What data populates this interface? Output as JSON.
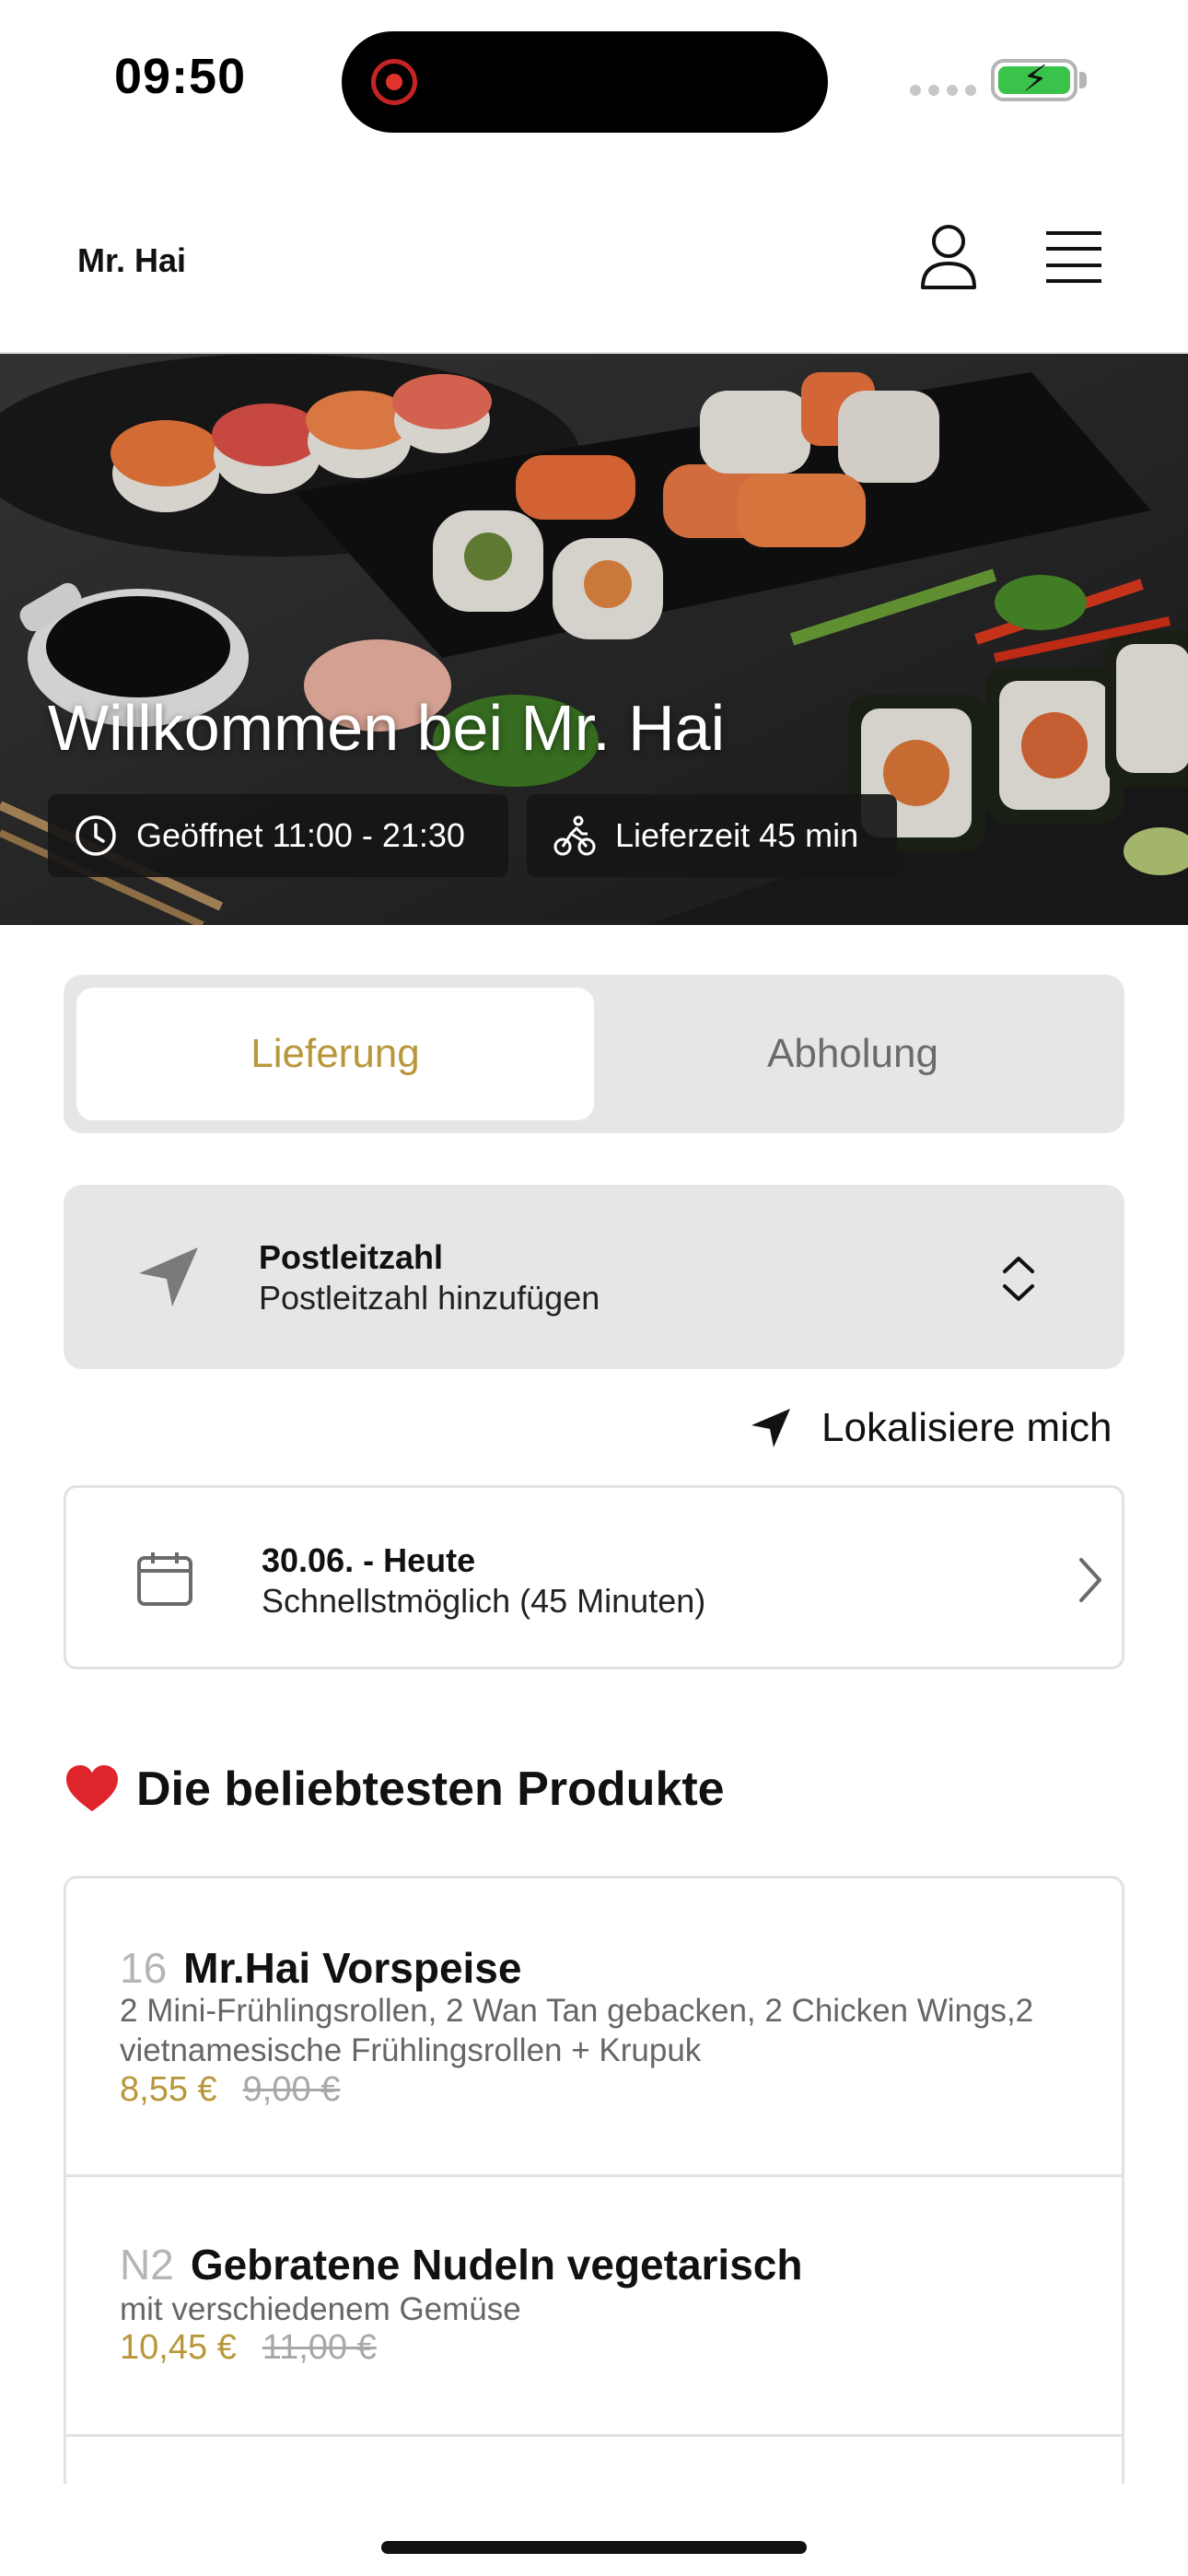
{
  "status_bar": {
    "time": "09:50"
  },
  "header": {
    "brand": "Mr. Hai",
    "icons": [
      "user-icon",
      "menu-icon"
    ]
  },
  "hero": {
    "title": "Willkommen bei Mr. Hai",
    "opening_hours": "Geöffnet 11:00 - 21:30",
    "delivery_time": "Lieferzeit 45 min"
  },
  "order_mode": {
    "options": [
      "Lieferung",
      "Abholung"
    ],
    "selected": "Lieferung"
  },
  "postcode": {
    "label": "Postleitzahl",
    "value": "Postleitzahl hinzufügen"
  },
  "locate": {
    "label": "Lokalisiere mich"
  },
  "date": {
    "label": "30.06. - Heute",
    "value": "Schnellstmöglich (45 Minuten)"
  },
  "popular": {
    "title": "Die beliebtesten Produkte",
    "products": [
      {
        "number": "16",
        "name": "Mr.Hai Vorspeise",
        "description": "2 Mini-Frühlingsrollen, 2 Wan Tan gebacken, 2 Chicken Wings,2 vietnamesische Frühlingsrollen + Krupuk",
        "price": "8,55 €",
        "old_price": "9,00 €"
      },
      {
        "number": "N2",
        "name": "Gebratene Nudeln vegetarisch",
        "description": "mit verschiedenem Gemüse",
        "price": "10,45 €",
        "old_price": "11,00 €"
      }
    ]
  },
  "colors": {
    "accent_gold": "#b8973b",
    "panel_gray": "#e6e6e6",
    "battery_green": "#3ac34a"
  }
}
